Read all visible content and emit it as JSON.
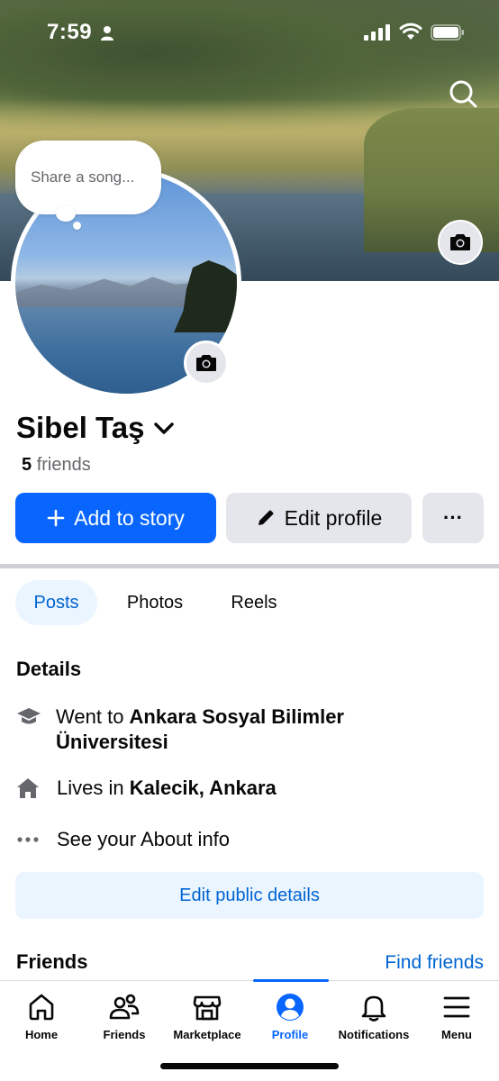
{
  "status_bar": {
    "time": "7:59"
  },
  "profile": {
    "thought_bubble_placeholder": "Share a song...",
    "name": "Sibel Taş",
    "friends_count": "5",
    "friends_label": "friends"
  },
  "actions": {
    "add_to_story": "Add to story",
    "edit_profile": "Edit profile",
    "more": "···"
  },
  "tabs": [
    {
      "label": "Posts",
      "active": true
    },
    {
      "label": "Photos",
      "active": false
    },
    {
      "label": "Reels",
      "active": false
    }
  ],
  "details": {
    "title": "Details",
    "school_prefix": "Went to ",
    "school_name": "Ankara Sosyal Bilimler Üniversitesi",
    "lives_prefix": "Lives in ",
    "lives_place": "Kalecik, Ankara",
    "about": "See your About info",
    "edit_public": "Edit public details"
  },
  "friends_section": {
    "title": "Friends",
    "find_friends": "Find friends"
  },
  "bottom_nav": [
    {
      "label": "Home",
      "icon": "home-icon"
    },
    {
      "label": "Friends",
      "icon": "friends-icon"
    },
    {
      "label": "Marketplace",
      "icon": "marketplace-icon"
    },
    {
      "label": "Profile",
      "icon": "profile-icon",
      "active": true
    },
    {
      "label": "Notifications",
      "icon": "bell-icon"
    },
    {
      "label": "Menu",
      "icon": "menu-icon"
    }
  ],
  "colors": {
    "accent": "#0866ff",
    "accent_text": "#0064d1",
    "secondary_bg": "#e4e6eb",
    "tinted_bg": "#ebf5ff"
  }
}
